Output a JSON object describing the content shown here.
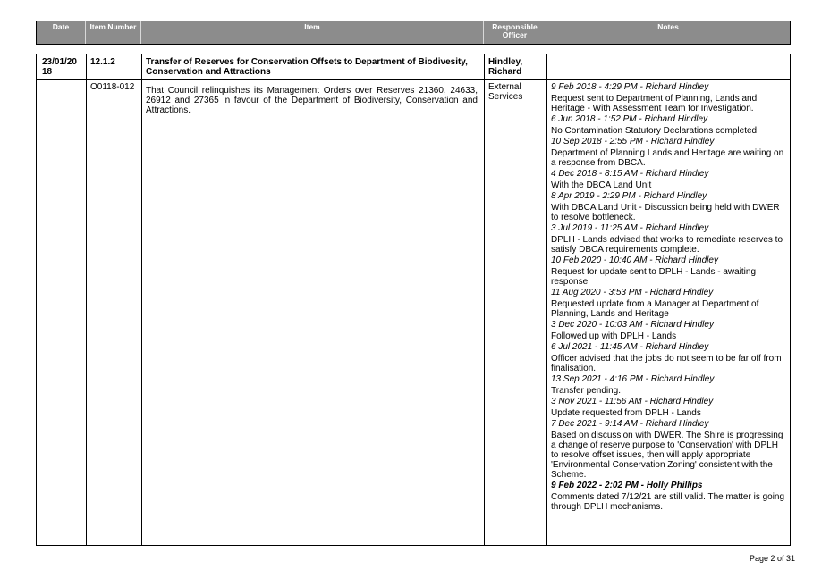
{
  "header": {
    "date": "Date",
    "item_number": "Item Number",
    "item": "Item",
    "responsible_officer": "Responsible Officer",
    "notes": "Notes"
  },
  "row": {
    "date": "23/01/20 18",
    "item_number": "12.1.2",
    "title": "Transfer of Reserves for Conservation Offsets to Department of Biodivesity, Conservation and Attractions",
    "officer": "Hindley, Richard",
    "sub_number": "O0118-012",
    "resolution": "That Council relinquishes its Management Orders over Reserves 21360, 24633, 26912 and 27365 in favour of the Department of Biodiversity, Conservation and Attractions.",
    "sub_officer": "External Services"
  },
  "notes": [
    {
      "ts": "9 Feb 2018 - 4:29 PM - Richard Hindley",
      "text": "Request sent to Department of Planning, Lands and Heritage - With Assessment Team for Investigation."
    },
    {
      "ts": "6 Jun 2018 - 1:52 PM - Richard Hindley",
      "text": "No Contamination Statutory Declarations completed."
    },
    {
      "ts": "10 Sep 2018 - 2:55 PM - Richard Hindley",
      "text": "Department of Planning Lands and Heritage are waiting on a response from DBCA."
    },
    {
      "ts": "4 Dec 2018 - 8:15 AM - Richard Hindley",
      "text": "With the DBCA Land Unit"
    },
    {
      "ts": "8 Apr 2019 - 2:29 PM - Richard Hindley",
      "text": "With DBCA Land Unit - Discussion being held with DWER to resolve bottleneck."
    },
    {
      "ts": "3 Jul 2019 - 11:25 AM - Richard Hindley",
      "text": "DPLH - Lands advised that works to remediate reserves to satisfy DBCA requirements complete."
    },
    {
      "ts": "10 Feb 2020 - 10:40 AM - Richard Hindley",
      "text": "Request for update sent to DPLH - Lands - awaiting response"
    },
    {
      "ts": "11 Aug 2020 - 3:53 PM - Richard Hindley",
      "text": "Requested update from a Manager at Department of Planning, Lands and Heritage"
    },
    {
      "ts": "3 Dec 2020 - 10:03 AM - Richard Hindley",
      "text": "Followed up with DPLH - Lands"
    },
    {
      "ts": "6 Jul 2021 - 11:45 AM - Richard Hindley",
      "text": "Officer advised that the jobs do not seem to be far off from finalisation."
    },
    {
      "ts": "13 Sep 2021 - 4:16 PM - Richard Hindley",
      "text": "Transfer pending."
    },
    {
      "ts": "3 Nov 2021 - 11:56 AM - Richard Hindley",
      "text": "Update requested from DPLH - Lands"
    },
    {
      "ts": "7 Dec 2021 - 9:14 AM - Richard Hindley",
      "text": "Based on discussion with DWER. The Shire is progressing a change of reserve purpose to 'Conservation' with DPLH to resolve offset issues, then will apply appropriate 'Environmental Conservation Zoning' consistent with the Scheme."
    },
    {
      "ts": "9 Feb 2022 - 2:02 PM - Holly Phillips",
      "text": "Comments dated 7/12/21 are still valid. The matter is going through DPLH mechanisms.",
      "bold": true
    }
  ],
  "footer": {
    "page": "Page 2 of 31"
  }
}
